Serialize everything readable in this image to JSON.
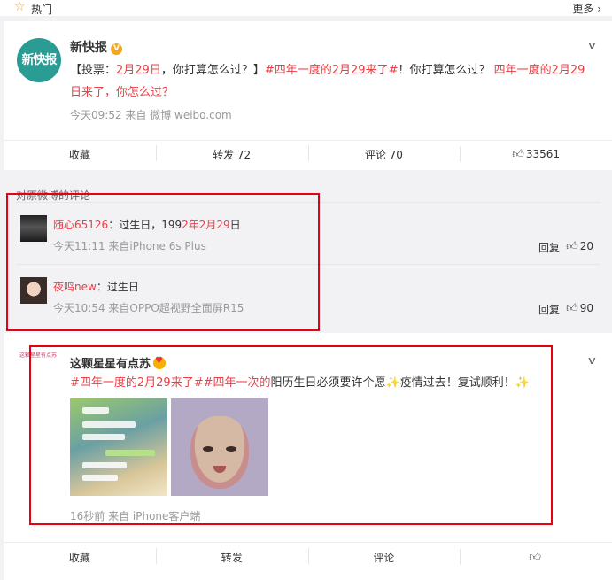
{
  "topbar": {
    "hot_label": "热门",
    "more_label": "更多 ›"
  },
  "post1": {
    "avatar_text": "新快报",
    "username": "新快报",
    "verified_badge": "V",
    "text_parts": [
      "【投票：",
      "2月29日",
      "，你打算怎么过？】",
      "#四年一度的2月29来了#",
      "！你打算怎么过？ ",
      "四年一度的2月29日来了，你怎么过？"
    ],
    "meta": "今天09:52  来自 微博 weibo.com",
    "actions": {
      "fav": "收藏",
      "repost": "转发 72",
      "comment": "评论 70",
      "like": "33561"
    }
  },
  "comments": {
    "title": "对原微博的评论",
    "items": [
      {
        "name": "随心65126",
        "sep": "：",
        "text_a": "过生日，199",
        "text_b": "2年2月29",
        "text_c": "日",
        "meta": "今天11:11  来自iPhone 6s Plus",
        "reply": "回复",
        "likes": "20"
      },
      {
        "name": "夜鸣new",
        "sep": "：",
        "text_a": "过生日",
        "text_b": "",
        "text_c": "",
        "meta": "今天10:54  来自OPPO超视野全面屏R15",
        "reply": "回复",
        "likes": "90"
      }
    ]
  },
  "post2": {
    "username": "这颗星星有点苏",
    "avatar_text": "这颗星星有点苏",
    "text_parts": [
      "#四年一度的2月29来了#",
      "#四年一次的",
      "阳历生日必须要许个愿",
      "✨",
      "疫情过去！复试顺利！",
      "✨"
    ],
    "meta": "16秒前  来自 iPhone客户端",
    "actions": {
      "fav": "收藏",
      "repost": "转发",
      "comment": "评论",
      "like": ""
    }
  },
  "colors": {
    "accent": "#eb3e45",
    "highlight_box": "#e60012"
  }
}
